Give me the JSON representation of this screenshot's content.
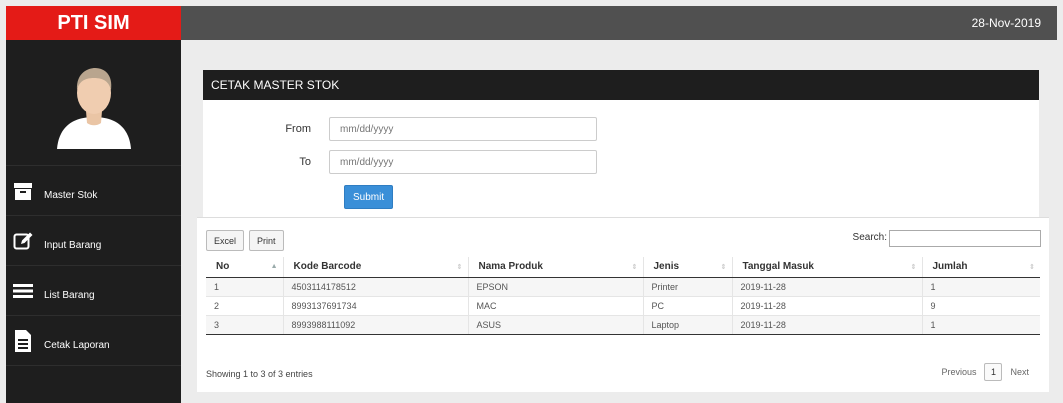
{
  "app": {
    "brand": "PTI SIM",
    "date": "28-Nov-2019"
  },
  "sidebar": {
    "avatar_icon": "user-avatar-icon",
    "items": [
      {
        "label": "Master Stok",
        "icon": "archive-box-icon"
      },
      {
        "label": "Input Barang",
        "icon": "edit-pencil-icon"
      },
      {
        "label": "List Barang",
        "icon": "list-bars-icon"
      },
      {
        "label": "Cetak Laporan",
        "icon": "document-icon"
      }
    ]
  },
  "form": {
    "title": "CETAK MASTER STOK",
    "from_label": "From",
    "from_placeholder": "mm/dd/yyyy",
    "to_label": "To",
    "to_placeholder": "mm/dd/yyyy",
    "submit_label": "Submit"
  },
  "table": {
    "excel_label": "Excel",
    "print_label": "Print",
    "search_label": "Search:",
    "columns": [
      "No",
      "Kode Barcode",
      "Nama Produk",
      "Jenis",
      "Tanggal Masuk",
      "Jumlah"
    ],
    "rows": [
      [
        "1",
        "4503114178512",
        "EPSON",
        "Printer",
        "2019-11-28",
        "1"
      ],
      [
        "2",
        "8993137691734",
        "MAC",
        "PC",
        "2019-11-28",
        "9"
      ],
      [
        "3",
        "8993988111092",
        "ASUS",
        "Laptop",
        "2019-11-28",
        "1"
      ]
    ],
    "info": "Showing 1 to 3 of 3 entries",
    "prev_label": "Previous",
    "current_page": "1",
    "next_label": "Next"
  },
  "colors": {
    "brand": "#e41b17",
    "sidebar": "#1e1e1e",
    "topbar": "#505050",
    "accent": "#3a8fd8"
  }
}
